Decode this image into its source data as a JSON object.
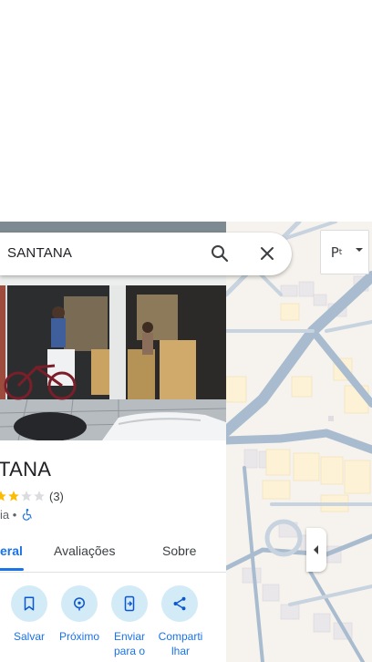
{
  "search": {
    "query": "SANTANA"
  },
  "layers": {
    "label": "P",
    "sub": "t"
  },
  "place": {
    "name": "TANA",
    "rating_count": "(3)",
    "category": "ia •"
  },
  "tabs": [
    {
      "label": "eral",
      "selected": true
    },
    {
      "label": "Avaliações"
    },
    {
      "label": "Sobre"
    }
  ],
  "actions": [
    {
      "label": "Salvar",
      "icon": "bookmark-icon"
    },
    {
      "label": "Próximo",
      "icon": "nearby-icon"
    },
    {
      "label": "Enviar para o",
      "icon": "send-to-phone-icon"
    },
    {
      "label": "Compartilhar",
      "icon": "share-icon"
    }
  ],
  "action_labels_visible": {
    "save": "Salvar",
    "nearby": "Próximo",
    "send_line1": "Enviar",
    "send_line2": "para o",
    "share_line1": "Comparti",
    "share_line2": "lhar"
  },
  "colors": {
    "accent": "#1a73e8",
    "action_bg": "#d3eaf7",
    "star_filled": "#fbbc04",
    "star_empty": "#dadce0",
    "map_road": "#a9bccf"
  }
}
